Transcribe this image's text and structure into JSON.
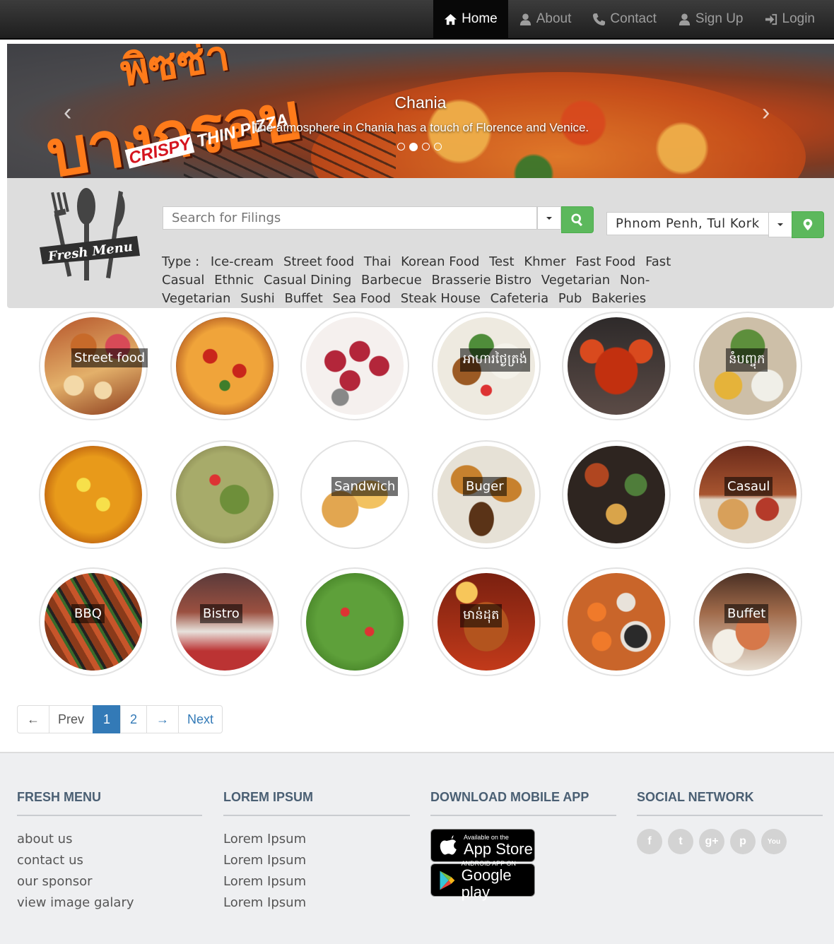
{
  "nav": {
    "items": [
      {
        "label": "Home",
        "icon": "home-icon",
        "active": true
      },
      {
        "label": "About",
        "icon": "user-icon",
        "active": false
      },
      {
        "label": "Contact",
        "icon": "phone-icon",
        "active": false
      },
      {
        "label": "Sign Up",
        "icon": "user-icon",
        "active": false
      },
      {
        "label": "Login",
        "icon": "login-icon",
        "active": false
      }
    ]
  },
  "carousel": {
    "title": "Chania",
    "text": "The atmosphere in Chania has a touch of Florence and Venice.",
    "banner_thai_top": "พิซซ่า",
    "banner_thai": "บางกรอบ",
    "banner_crispy": "CRISPY",
    "banner_thin": "THIN PIZZA",
    "slide_count": 4,
    "active_slide": 2,
    "prev_glyph": "‹",
    "next_glyph": "›"
  },
  "search": {
    "logo_text": "Fresh Menu",
    "placeholder": "Search for Filings",
    "location_value": "Phnom Penh, Tul Kork",
    "type_label": "Type :",
    "types": [
      "Ice-cream",
      "Street food",
      "Thai",
      "Korean Food",
      "Test",
      "Khmer",
      "Fast Food",
      "Fast Casual",
      "Ethnic",
      "Casual Dining",
      "Barbecue",
      "Brasserie Bistro",
      "Vegetarian",
      "Non-Vegetarian",
      "Sushi",
      "Buffet",
      "Sea Food",
      "Steak House",
      "Cafeteria",
      "Pub",
      "Bakeries"
    ]
  },
  "grid": {
    "items": [
      {
        "label": "Street food"
      },
      {
        "label": ""
      },
      {
        "label": ""
      },
      {
        "label": "អាហារថ្ងៃត្រង់"
      },
      {
        "label": ""
      },
      {
        "label": "នំបញ្ចុក"
      },
      {
        "label": ""
      },
      {
        "label": ""
      },
      {
        "label": "Sandwich"
      },
      {
        "label": "Buger"
      },
      {
        "label": ""
      },
      {
        "label": "Casaul"
      },
      {
        "label": "BBQ"
      },
      {
        "label": "Bistro"
      },
      {
        "label": ""
      },
      {
        "label": "មាន់ដុត"
      },
      {
        "label": ""
      },
      {
        "label": "Buffet"
      }
    ]
  },
  "pagination": {
    "first": "←",
    "prev": "Prev",
    "pages": [
      "1",
      "2"
    ],
    "active_page": "1",
    "next_arrow": "→",
    "next": "Next"
  },
  "footer": {
    "col1": {
      "title": "FRESH MENU",
      "links": [
        "about us",
        "contact us",
        "our sponsor",
        "view image galary"
      ]
    },
    "col2": {
      "title": "LOREM IPSUM",
      "links": [
        "Lorem Ipsum",
        "Lorem Ipsum",
        "Lorem Ipsum",
        "Lorem Ipsum"
      ]
    },
    "col3": {
      "title": "DOWNLOAD MOBILE APP",
      "appstore_small": "Available on the",
      "appstore_big": "App Store",
      "gplay_small": "ANDROID APP ON",
      "gplay_big": "Google play"
    },
    "col4": {
      "title": "SOCIAL NETWORK",
      "icons": [
        "facebook-icon",
        "twitter-icon",
        "google-plus-icon",
        "pinterest-icon",
        "youtube-icon"
      ],
      "glyphs": [
        "f",
        "t",
        "g+",
        "p",
        "You"
      ]
    }
  }
}
